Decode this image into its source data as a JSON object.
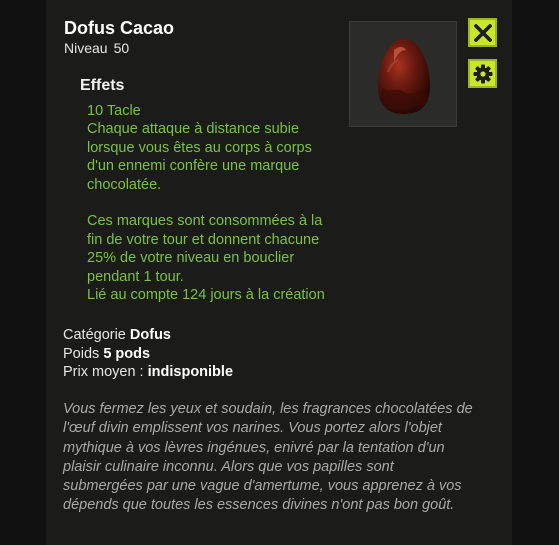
{
  "item": {
    "name": "Dofus Cacao",
    "level_label": "Niveau",
    "level_value": "50",
    "image_icon": "chocolate-egg-icon"
  },
  "controls": {
    "close_icon": "close-icon",
    "settings_icon": "gear-icon",
    "accent_color": "#c8e62a"
  },
  "effects": {
    "heading": "Effets",
    "lines": [
      "10 Tacle",
      "Chaque attaque à distance subie\nlorsque vous êtes au corps à corps\nd'un ennemi confère une marque\nchocolatée.",
      "Ces marques sont consommées à la\nfin de votre tour et donnent chacune\n25% de votre niveau en bouclier\npendant 1 tour.",
      "Lié au compte 124 jours à la création"
    ],
    "text_color": "#7bc142"
  },
  "stats": {
    "category_label": "Catégorie",
    "category_value": "Dofus",
    "weight_label": "Poids",
    "weight_value": "5 pods",
    "price_label": "Prix moyen :",
    "price_value": "indisponible"
  },
  "description": "Vous fermez les yeux et soudain, les fragrances chocolatées de l'œuf divin emplissent vos narines. Vous portez alors l'objet mythique à vos lèvres ingénues, enivré par la tentation d'un plaisir culinaire inconnu. Alors que vos papilles sont submergées par une vague d'amertume, vous apprenez à vos dépends que toutes les essences divines n'ont pas bon goût."
}
